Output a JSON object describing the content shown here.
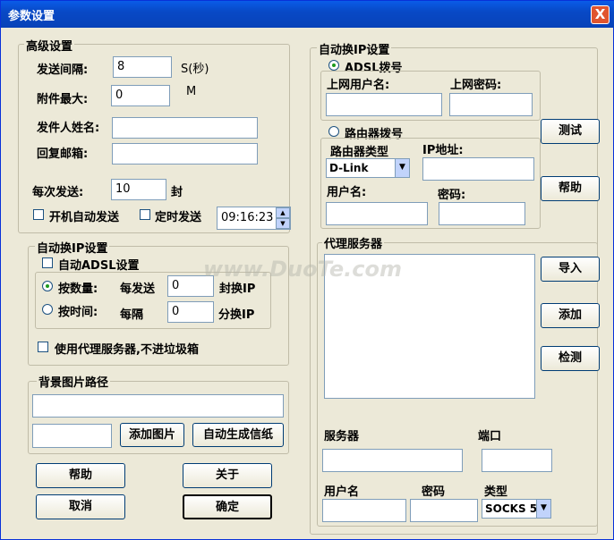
{
  "window": {
    "title": "参数设置",
    "close": "X"
  },
  "advanced": {
    "title": "高级设置",
    "send_interval_label": "发送间隔:",
    "send_interval_value": "8",
    "send_interval_unit": "S(秒)",
    "attach_max_label": "附件最大:",
    "attach_max_value": "0",
    "attach_max_unit": "M",
    "sender_name_label": "发件人姓名:",
    "sender_name_value": "",
    "reply_email_label": "回复邮箱:",
    "reply_email_value": "",
    "per_send_label": "每次发送:",
    "per_send_value": "10",
    "per_send_unit": "封",
    "auto_start_label": "开机自动发送",
    "timed_send_label": "定时发送",
    "time_value": "09:16:23"
  },
  "auto_ip": {
    "title": "自动换IP设置",
    "auto_adsl_label": "自动ADSL设置",
    "by_count_label": "按数量:",
    "every_send_label": "每发送",
    "count_value": "0",
    "count_unit": "封换IP",
    "by_time_label": "按时间:",
    "every_label": "每隔",
    "time_value": "0",
    "time_unit": "分换IP",
    "use_proxy_label": "使用代理服务器,不进垃圾箱"
  },
  "background": {
    "title": "背景图片路径",
    "path_value": "",
    "small_value": "",
    "add_image": "添加图片",
    "auto_gen": "自动生成信纸"
  },
  "bottom": {
    "help": "帮助",
    "about": "关于",
    "cancel": "取消",
    "ok": "确定"
  },
  "right": {
    "title": "自动换IP设置",
    "adsl_label": "ADSL拨号",
    "user_label": "上网用户名:",
    "pass_label": "上网密码:",
    "user_value": "",
    "pass_value": "",
    "router_label": "路由器拨号",
    "router_type_label": "路由器类型",
    "ip_label": "IP地址:",
    "router_type_value": "D-Link",
    "ip_value": "",
    "router_user_label": "用户名:",
    "router_pass_label": "密码:",
    "router_user_value": "",
    "router_pass_value": "",
    "test": "测试",
    "help": "帮助"
  },
  "proxy": {
    "title": "代理服务器",
    "import": "导入",
    "add": "添加",
    "check": "检测",
    "server_label": "服务器",
    "port_label": "端口",
    "server_value": "",
    "port_value": "",
    "user_label": "用户名",
    "pass_label": "密码",
    "type_label": "类型",
    "user_value": "",
    "pass_value": "",
    "type_value": "SOCKS 5"
  },
  "watermark": "www.DuoTe.com"
}
